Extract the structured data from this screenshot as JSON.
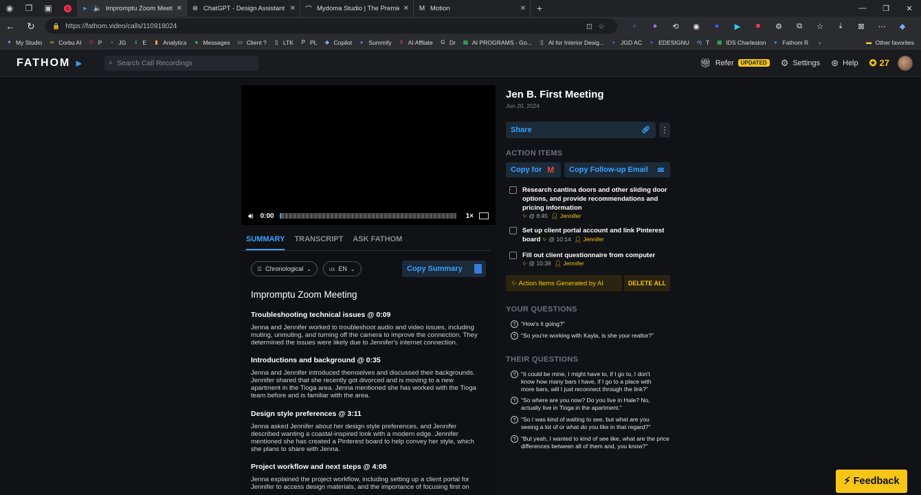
{
  "browser": {
    "tabs": [
      {
        "title": "Impromptu Zoom Meeting",
        "active": true
      },
      {
        "title": "ChatGPT - Design Assistant"
      },
      {
        "title": "Mydoma Studio | The Premier Pl"
      },
      {
        "title": "Motion"
      }
    ],
    "url": "https://fathom.video/calls/110918024",
    "bookmarks": [
      "My Studio",
      "Corbu AI",
      "P",
      "JG",
      "E",
      "Analytics",
      "Messages",
      "Client ?",
      "LTK",
      "PL",
      "Copilot",
      "Summify",
      "AI Affliate",
      "Dr",
      "AI PROGRAMS - Go...",
      "AI for Interior Desig...",
      "JGD AC",
      "EDESIGNU",
      "T",
      "IDS Charleston",
      "Fathom R"
    ],
    "other_favorites": "Other favorites"
  },
  "header": {
    "logo": "FATHOM",
    "search_placeholder": "Search Call Recordings",
    "refer": "Refer",
    "updated_badge": "UPDATED",
    "settings": "Settings",
    "help": "Help",
    "stars": "27"
  },
  "video": {
    "time": "0:00",
    "speed": "1×"
  },
  "left_tabs": [
    "SUMMARY",
    "TRANSCRIPT",
    "ASK FATHOM"
  ],
  "summary": {
    "sort_label": "Chronological",
    "lang_prefix": "us",
    "lang_label": "EN",
    "copy_label": "Copy Summary",
    "title": "Impromptu Zoom Meeting",
    "sections": [
      {
        "heading": "Troubleshooting technical issues @ 0:09",
        "text": "Jenna and Jennifer worked to troubleshoot audio and video issues, including muting, unmuting, and turning off the camera to improve the connection. They determined the issues were likely due to Jennifer's internet connection."
      },
      {
        "heading": "Introductions and background @ 0:35",
        "text": "Jenna and Jennifer introduced themselves and discussed their backgrounds. Jennifer shared that she recently got divorced and is moving to a new apartment in the Tioga area. Jenna mentioned she has worked with the Tioga team before and is familiar with the area."
      },
      {
        "heading": "Design style preferences @ 3:11",
        "text": "Jenna asked Jennifer about her design style preferences, and Jennifer described wanting a coastal-inspired look with a modern edge. Jennifer mentioned she has created a Pinterest board to help convey her style, which she plans to share with Jenna."
      },
      {
        "heading": "Project workflow and next steps @ 4:08",
        "text": "Jenna explained the project workflow, including setting up a client portal for Jennifer to access design materials, and the importance of focusing first on"
      }
    ]
  },
  "meeting": {
    "title": "Jen B. First Meeting",
    "date": "Jun 20, 2024",
    "share_label": "Share"
  },
  "action_items": {
    "heading": "ACTION ITEMS",
    "copy_for": "Copy for",
    "copy_followup": "Copy Follow-up Email",
    "items": [
      {
        "text": "Research cantina doors and other sliding door options, and provide recommendations and pricing information",
        "time": "@ 8:45",
        "person": "Jennifer"
      },
      {
        "text": "Set up client portal account and link Pinterest board",
        "time": "@ 10:14",
        "person": "Jennifer"
      },
      {
        "text": "Fill out client questionnaire from computer",
        "time": "@ 10:38",
        "person": "Jennifer"
      }
    ],
    "generated_label": "Action Items Generated by AI",
    "delete_all": "DELETE ALL"
  },
  "your_questions": {
    "heading": "YOUR QUESTIONS",
    "items": [
      "“How's it going?”",
      "“So you're working with Kayla, is she your realtor?”"
    ]
  },
  "their_questions": {
    "heading": "THEIR QUESTIONS",
    "items": [
      "“It could be mine, I might have to, if I go to, I don't know how many bars I have, if I go to a place with more bars, will I just reconnect through the link?”",
      "“So where are you now? Do you live in Hale? No, actually live in Tioga in the apartment.”",
      "“So I was kind of waiting to see, but what are you seeing a lot of or what do you like in that regard?”",
      "“But yeah, I wanted to kind of see like, what are the price differences between all of them and, you know?”"
    ]
  },
  "feedback_label": "Feedback"
}
